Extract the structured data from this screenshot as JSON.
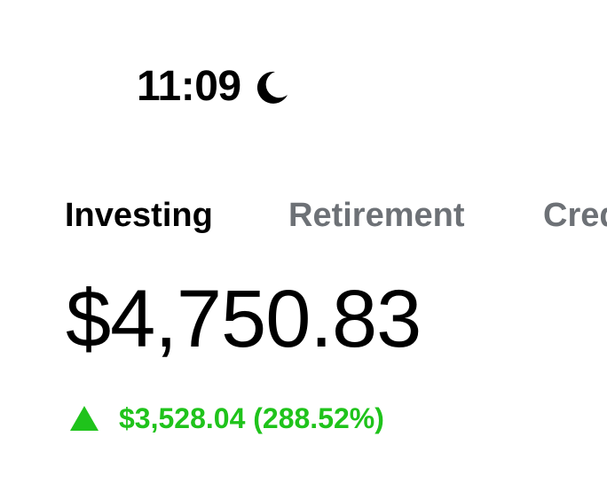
{
  "status_bar": {
    "time": "11:09",
    "focus_icon": "moon-icon"
  },
  "tabs": [
    {
      "label": "Investing",
      "active": true
    },
    {
      "label": "Retirement",
      "active": false
    },
    {
      "label": "Credit",
      "active": false
    }
  ],
  "portfolio": {
    "balance": "$4,750.83",
    "change": "$3,528.04 (288.52%)",
    "change_direction_icon": "up-triangle-icon"
  },
  "colors": {
    "positive": "#1fc31b",
    "inactive_tab": "#6d7176",
    "text": "#000000",
    "background": "#ffffff"
  }
}
